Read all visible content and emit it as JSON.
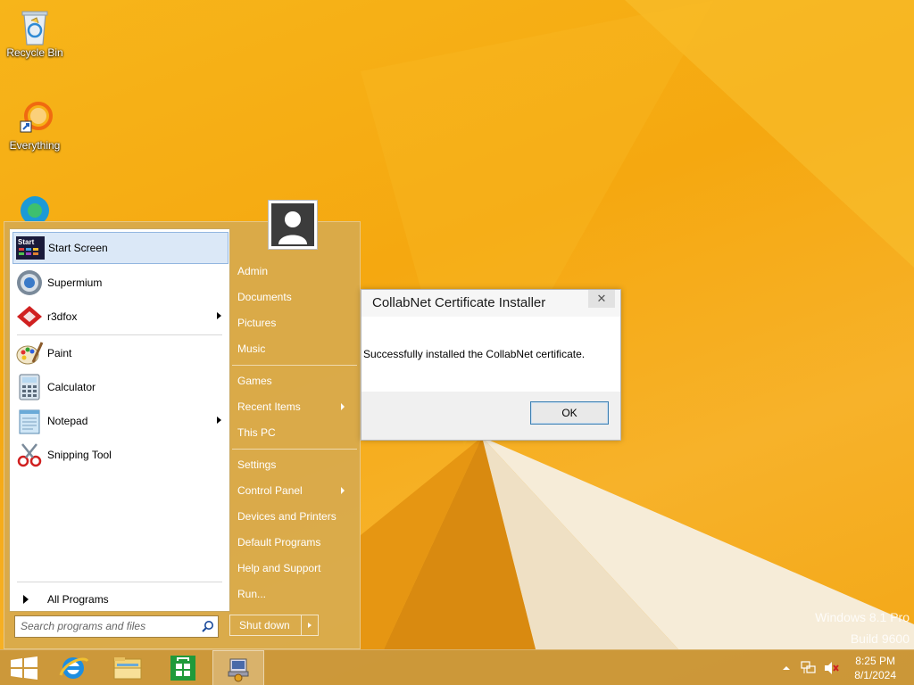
{
  "desktop": {
    "icons": [
      {
        "label": "Recycle Bin"
      },
      {
        "label": "Everything"
      }
    ]
  },
  "start_menu": {
    "programs": [
      {
        "label": "Start Screen"
      },
      {
        "label": "Supermium"
      },
      {
        "label": "r3dfox"
      },
      {
        "label": "Paint"
      },
      {
        "label": "Calculator"
      },
      {
        "label": "Notepad"
      },
      {
        "label": "Snipping Tool"
      }
    ],
    "start_screen_icon_text": "Start",
    "all_programs_label": "All Programs",
    "search_placeholder": "Search programs and files",
    "right_links": [
      {
        "label": "Admin"
      },
      {
        "label": "Documents"
      },
      {
        "label": "Pictures"
      },
      {
        "label": "Music"
      },
      {
        "label": "Games"
      },
      {
        "label": "Recent Items"
      },
      {
        "label": "This PC"
      },
      {
        "label": "Settings"
      },
      {
        "label": "Control Panel"
      },
      {
        "label": "Devices and Printers"
      },
      {
        "label": "Default Programs"
      },
      {
        "label": "Help and Support"
      },
      {
        "label": "Run..."
      }
    ],
    "shutdown_label": "Shut down"
  },
  "dialog": {
    "title": "CollabNet Certificate Installer",
    "close_glyph": "✕",
    "message": "Successfully installed the CollabNet certificate.",
    "ok_label": "OK"
  },
  "watermark": {
    "line1": "Windows 8.1 Pro",
    "line2": "Build 9600"
  },
  "taskbar": {
    "time": "8:25 PM",
    "date": "8/1/2024"
  }
}
